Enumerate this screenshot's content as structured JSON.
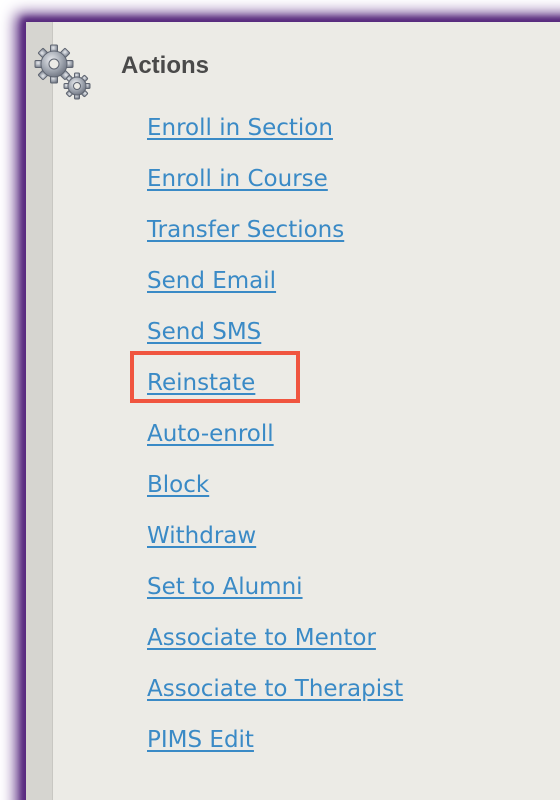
{
  "panel": {
    "title": "Actions",
    "icon": "gears-icon",
    "accent_color": "#3a8ac6",
    "highlight_color": "#f0553f",
    "highlighted_item": "Reinstate"
  },
  "actions": [
    "Enroll in Section",
    "Enroll in Course",
    "Transfer Sections",
    "Send Email",
    "Send SMS",
    "Reinstate",
    "Auto-enroll",
    "Block",
    "Withdraw",
    "Set to Alumni",
    "Associate to Mentor",
    "Associate to Therapist",
    "PIMS Edit"
  ]
}
